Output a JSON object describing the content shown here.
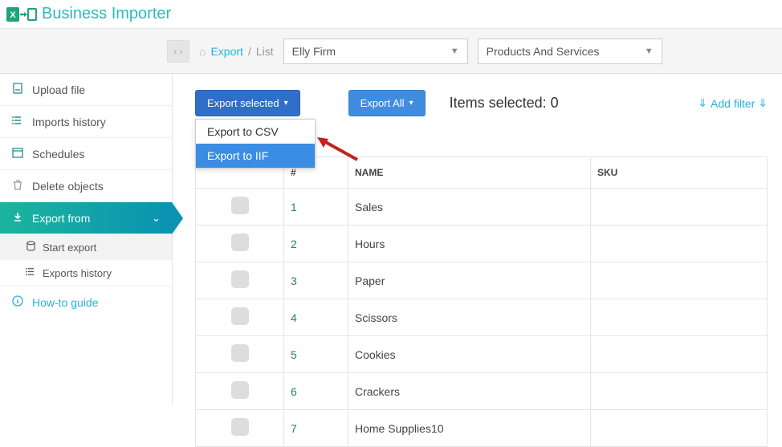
{
  "app": {
    "title": "Business Importer"
  },
  "breadcrumb": {
    "export": "Export",
    "list": "List"
  },
  "selects": {
    "company": "Elly Firm",
    "entity": "Products And Services"
  },
  "sidebar": {
    "upload": "Upload file",
    "imports_history": "Imports history",
    "schedules": "Schedules",
    "delete_objects": "Delete objects",
    "export_from": "Export from",
    "start_export": "Start export",
    "exports_history": "Exports history",
    "how_to": "How-to guide"
  },
  "buttons": {
    "export_selected": "Export selected",
    "export_all": "Export All",
    "add_filter": "Add filter"
  },
  "dropdown": {
    "csv": "Export to CSV",
    "iif": "Export to IIF"
  },
  "status": {
    "items_selected_label": "Items selected:",
    "items_selected_count": "0"
  },
  "table": {
    "col_num": "#",
    "col_name": "NAME",
    "col_sku": "SKU",
    "rows": [
      {
        "n": "1",
        "name": "Sales",
        "sku": ""
      },
      {
        "n": "2",
        "name": "Hours",
        "sku": ""
      },
      {
        "n": "3",
        "name": "Paper",
        "sku": ""
      },
      {
        "n": "4",
        "name": "Scissors",
        "sku": ""
      },
      {
        "n": "5",
        "name": "Cookies",
        "sku": ""
      },
      {
        "n": "6",
        "name": "Crackers",
        "sku": ""
      },
      {
        "n": "7",
        "name": "Home Supplies10",
        "sku": ""
      }
    ]
  }
}
